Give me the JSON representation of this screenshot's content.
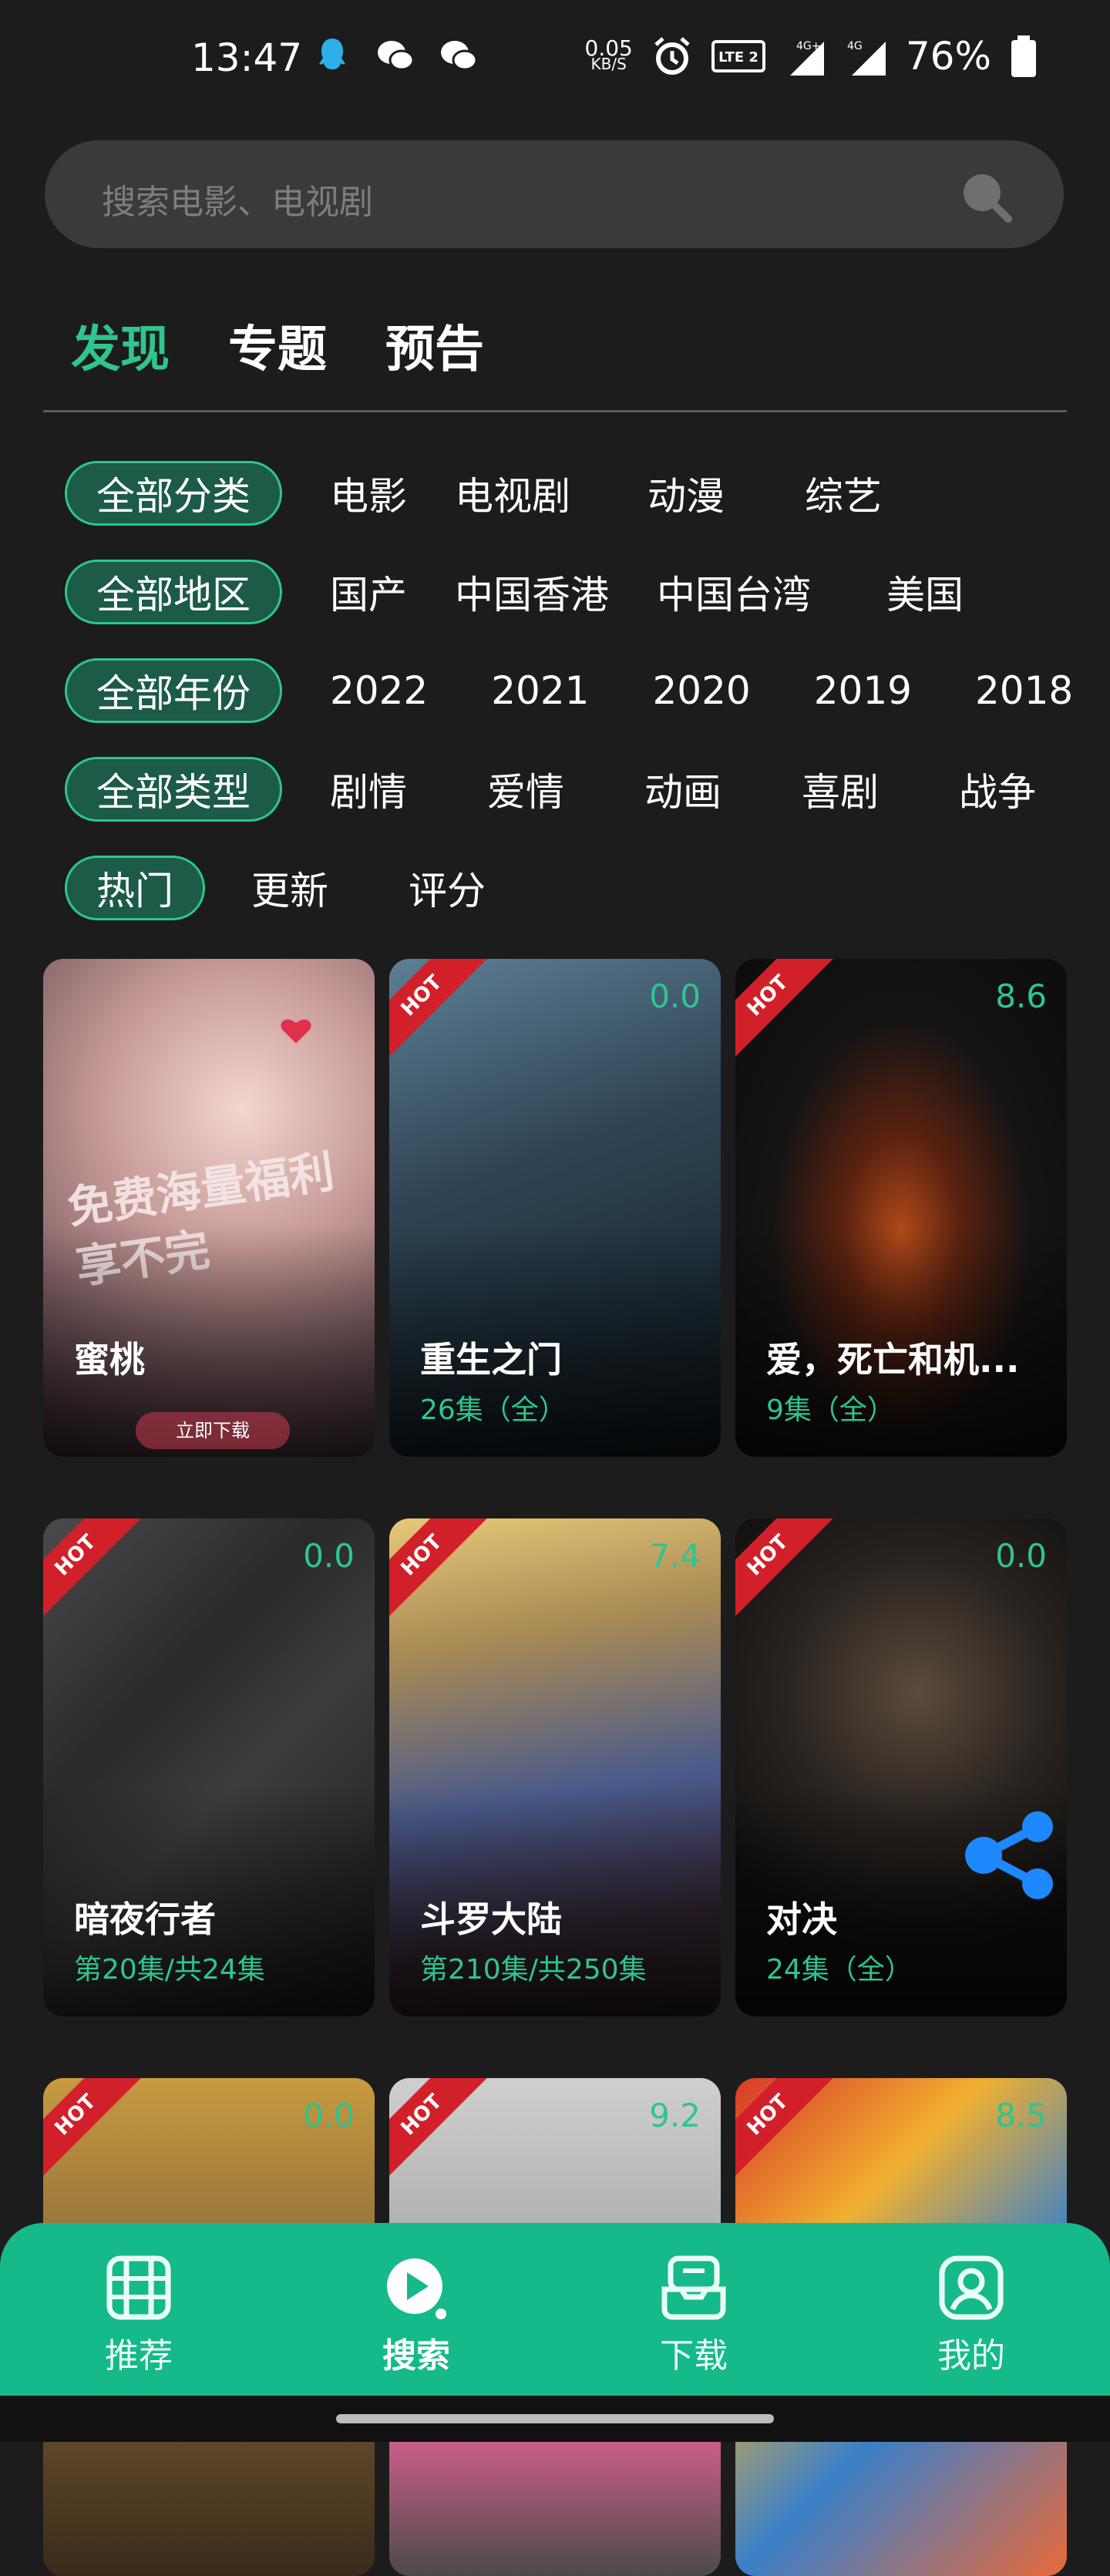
{
  "status_bar": {
    "time": "13:47",
    "net_speed_value": "0.05",
    "net_speed_unit": "KB/S",
    "volte": "VoLTE 2",
    "signal1": "4G+",
    "signal2": "4G",
    "battery": "76%"
  },
  "search": {
    "placeholder": "搜索电影、电视剧"
  },
  "tabs": [
    {
      "label": "发现",
      "active": true
    },
    {
      "label": "专题",
      "active": false
    },
    {
      "label": "预告",
      "active": false
    }
  ],
  "filters": {
    "category": {
      "selected": "全部分类",
      "options": [
        "电影",
        "电视剧",
        "动漫",
        "综艺"
      ]
    },
    "region": {
      "selected": "全部地区",
      "options": [
        "国产",
        "中国香港",
        "中国台湾",
        "美国"
      ]
    },
    "year": {
      "selected": "全部年份",
      "options": [
        "2022",
        "2021",
        "2020",
        "2019",
        "2018"
      ]
    },
    "genre": {
      "selected": "全部类型",
      "options": [
        "剧情",
        "爱情",
        "动画",
        "喜剧",
        "战争"
      ]
    },
    "sort": {
      "selected": "热门",
      "options": [
        "更新",
        "评分"
      ]
    }
  },
  "cards": [
    {
      "title": "蜜桃",
      "subtitle": "",
      "score": "",
      "hot": false,
      "ad_text_1": "免费海量福利",
      "ad_text_2": "享不完",
      "ad_button": "立即下载"
    },
    {
      "title": "重生之门",
      "subtitle": "26集（全）",
      "score": "0.0",
      "hot": true
    },
    {
      "title": "爱，死亡和机...",
      "subtitle": "9集（全）",
      "score": "8.6",
      "hot": true
    },
    {
      "title": "暗夜行者",
      "subtitle": "第20集/共24集",
      "score": "0.0",
      "hot": true
    },
    {
      "title": "斗罗大陆",
      "subtitle": "第210集/共250集",
      "score": "7.4",
      "hot": true
    },
    {
      "title": "对决",
      "subtitle": "24集（全）",
      "score": "0.0",
      "hot": true
    },
    {
      "title": "",
      "subtitle": "",
      "score": "0.0",
      "hot": true
    },
    {
      "title": "",
      "subtitle": "",
      "score": "9.2",
      "hot": true
    },
    {
      "title": "",
      "subtitle": "",
      "score": "8.5",
      "hot": true
    }
  ],
  "hot_label": "HOT",
  "bottom_nav": [
    {
      "label": "推荐",
      "icon": "film-icon",
      "active": false
    },
    {
      "label": "搜索",
      "icon": "play-icon",
      "active": true
    },
    {
      "label": "下载",
      "icon": "download-icon",
      "active": false
    },
    {
      "label": "我的",
      "icon": "profile-icon",
      "active": false
    }
  ],
  "colors": {
    "accent": "#2ec58f",
    "nav": "#16b98a",
    "hot": "#d2202a",
    "background": "#1c1c1c"
  }
}
